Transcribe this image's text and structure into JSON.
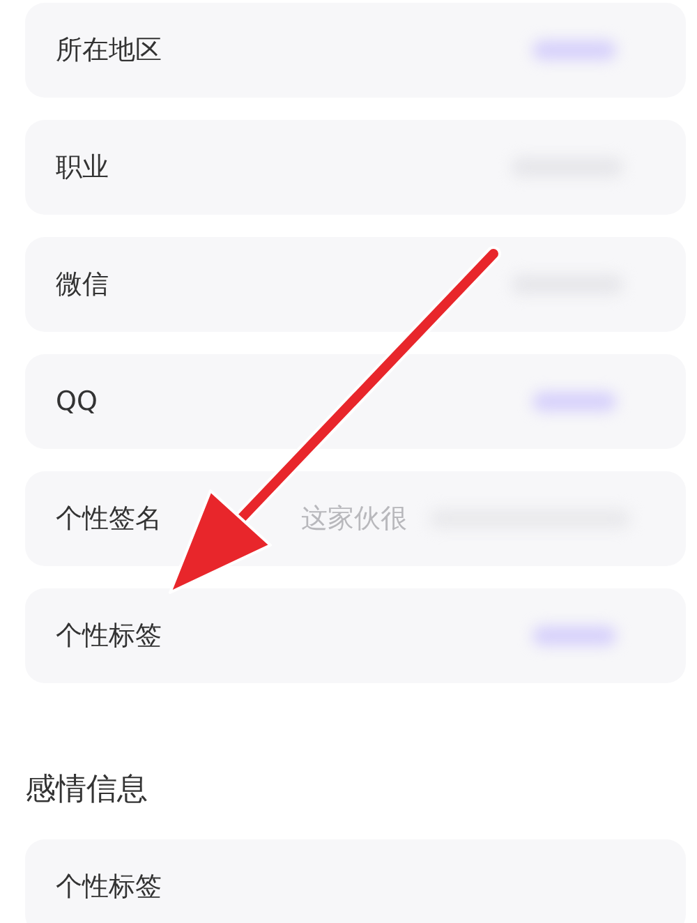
{
  "rows": [
    {
      "label": "所在地区",
      "kind": "accent"
    },
    {
      "label": "职业",
      "kind": "plain"
    },
    {
      "label": "微信",
      "kind": "plain"
    },
    {
      "label": "QQ",
      "kind": "accent"
    },
    {
      "label": "个性签名",
      "kind": "hint",
      "value": "这家伙很"
    },
    {
      "label": "个性标签",
      "kind": "accent"
    }
  ],
  "section": {
    "title": "感情信息",
    "rows": [
      {
        "label": "个性标签"
      }
    ]
  },
  "annotation": {
    "kind": "arrow"
  }
}
